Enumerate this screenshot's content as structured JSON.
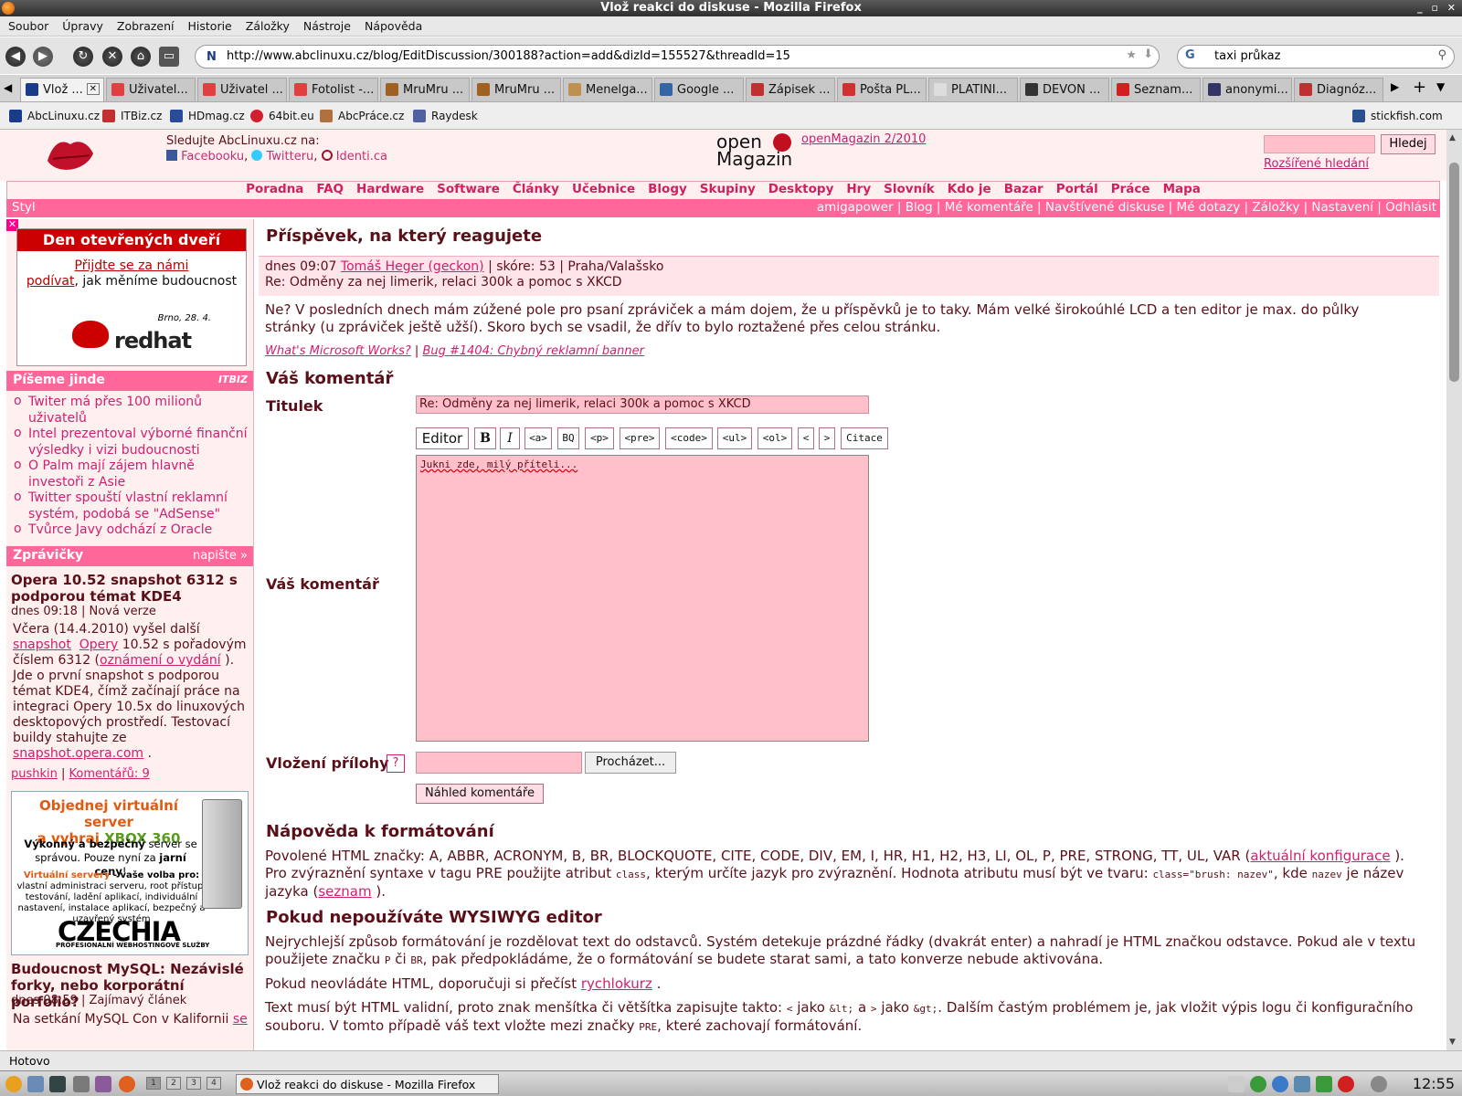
{
  "window": {
    "title": "Vlož reakci do diskuse - Mozilla Firefox"
  },
  "menu": [
    "Soubor",
    "Úpravy",
    "Zobrazení",
    "Historie",
    "Záložky",
    "Nástroje",
    "Nápověda"
  ],
  "nav": {
    "url": "http://www.abclinuxu.cz/blog/EditDiscussion/300188?action=add&dizId=155527&threadId=15",
    "search": "taxi průkaz"
  },
  "tabs": [
    {
      "label": "Vlož ...",
      "color": "#1a3a8a"
    },
    {
      "label": "Uživatel...",
      "color": "#e04040"
    },
    {
      "label": "Uživatel ...",
      "color": "#e04040"
    },
    {
      "label": "Fotolist -...",
      "color": "#e04040"
    },
    {
      "label": "MruMru ...",
      "color": "#a06020"
    },
    {
      "label": "MruMru ...",
      "color": "#a06020"
    },
    {
      "label": "Menelga...",
      "color": "#c09050"
    },
    {
      "label": "Google ...",
      "color": "#3465a4"
    },
    {
      "label": "Zápisek ...",
      "color": "#c03030"
    },
    {
      "label": "Pošta PL...",
      "color": "#d03030"
    },
    {
      "label": "PLATINI...",
      "color": "#dddddd"
    },
    {
      "label": "DEVON ...",
      "color": "#333333"
    },
    {
      "label": "Seznam...",
      "color": "#d02020"
    },
    {
      "label": "anonymi...",
      "color": "#333366"
    },
    {
      "label": "Diagnóz...",
      "color": "#c03030"
    }
  ],
  "bookmarks": [
    "AbcLinuxu.cz",
    "ITBiz.cz",
    "HDmag.cz",
    "64bit.eu",
    "AbcPráce.cz",
    "Raydesk"
  ],
  "bookmark_right": "stickfish.com",
  "header": {
    "follow_label": "Sledujte AbcLinuxu.cz na:",
    "facebook": "Facebooku",
    "twitter": "Twitteru",
    "identica": "Identi.ca",
    "om_logo_1": "open",
    "om_logo_2": "Magazin",
    "om_link": "openMagazin 2/2010",
    "search_button": "Hledej",
    "advanced_search": "Rozšířené hledání"
  },
  "topnav": [
    "Poradna",
    "FAQ",
    "Hardware",
    "Software",
    "Články",
    "Učebnice",
    "Blogy",
    "Skupiny",
    "Desktopy",
    "Hry",
    "Slovník",
    "Kdo je",
    "Bazar",
    "Portál",
    "Práce",
    "Mapa"
  ],
  "userbar": {
    "styl": "Styl",
    "links": "amigapower | Blog | Mé komentáře | Navštívené diskuse | Mé dotazy | Záložky | Nastavení | Odhlásit"
  },
  "sidebar": {
    "ad": {
      "title": "Den otevřených dveří",
      "link1": "Přijdte se za námi",
      "link2": "podívat",
      "text": ", jak měníme budoucnost",
      "date": "Brno, 28. 4.",
      "brand": "redhat"
    },
    "piseme": {
      "title": "Píšeme jinde",
      "badge": "ITBIZ",
      "items": [
        "Twiter má přes 100 milionů uživatelů",
        "Intel prezentoval výborné finanční výsledky i vizi budoucnosti",
        "O Palm mají zájem hlavně investoři z Asie",
        "Twitter spouští vlastní reklamní systém, podobá se \"AdSense\"",
        "Tvůrce Javy odchází z Oracle"
      ]
    },
    "zpravicky": {
      "title": "Zprávičky",
      "action": "napište »"
    },
    "news1": {
      "title": "Opera 10.52 snapshot 6312 s podporou témat KDE4",
      "meta": "dnes 09:18 | Nová verze",
      "t1": "Včera (14.4.2010) vyšel další ",
      "l1": "snapshot",
      "l2": "Opery",
      "t2": " 10.52 s pořadovým číslem 6312 (",
      "l3": "oznámení o vydání",
      "t3": " ). Jde o první snapshot s podporou témat KDE4, čímž začínají práce na integraci Opery 10.5x do linuxových desktopových prostředí. Testovací buildy stahujte ze ",
      "l4": "snapshot.opera.com",
      "t4": " .",
      "author": "pushkin",
      "comments": "Komentářů: 9"
    },
    "czechia": {
      "t1a": "Objednej virtuální server",
      "t1b": "a vyhraj ",
      "t1c": "XBOX 360",
      "t2a": "Výkonný a bezpečný",
      "t2b": " server se správou. Pouze nyní za ",
      "t2c": "jarní ceny",
      "t2d": "!",
      "t3a": "Virtuální servery",
      "t3b": " - vaše volba pro:",
      "t3c": "vlastní administraci serveru, root přístup, testování, ladění aplikací, individuální nastavení, instalace aplikací, bezpečný a uzavřený systém",
      "logo": "CZECHIA",
      "sub": "PROFESIONÁLNÍ WEBHOSTINGOVÉ SLUŽBY"
    },
    "news2": {
      "title": "Budoucnost MySQL: Nezávislé forky, nebo korporátní porfolio?",
      "meta": "dnes 08:59 | Zajímavý článek",
      "t1": "Na setkání MySQL Con v Kalifornii ",
      "l1": "se"
    }
  },
  "main": {
    "orig_heading": "Příspěvek, na který reagujete",
    "orig_time": "dnes 09:07 ",
    "orig_author": "Tomáš Heger (geckon)",
    "orig_meta": " | skóre: 53 | Praha/Valašsko",
    "orig_subject": "Re: Odměny za nej limerik, relaci 300k a pomoc s XKCD",
    "orig_text": "Ne? V posledních dnech mám zúžené pole pro psaní zpráviček a mám dojem, že u příspěvků je to taky. Mám velké širokoúhlé LCD a ten editor je max. do půlky stránky (u zpráviček ještě užší). Skoro bych se vsadil, že dřív to bylo roztažené přes celou stránku.",
    "sig1": "What's Microsoft Works?",
    "sig_sep": " | ",
    "sig2": "Bug #1404: Chybný reklamní banner",
    "comment_heading": "Váš komentář",
    "title_label": "Titulek",
    "title_value": "Re: Odměny za nej limerik, relaci 300k a pomoc s XKCD",
    "toolbar": [
      "Editor",
      "B",
      "I",
      "<a>",
      "BQ",
      "<p>",
      "<pre>",
      "<code>",
      "<ul>",
      "<ol>",
      "<",
      ">",
      "Citace"
    ],
    "comment_label": "Váš komentář",
    "comment_value": "Jukni zde, milý příteli...",
    "attach_label": "Vložení přílohy",
    "help": "?",
    "browse": "Procházet...",
    "preview": "Náhled komentáře",
    "fmt_heading": "Nápověda k formátování",
    "fmt1": "Povolené HTML značky: A, ABBR, ACRONYM, B, BR, BLOCKQUOTE, CITE, CODE, DIV, EM, I, HR, H1, H2, H3, LI, OL, P, PRE, STRONG, TT, UL, VAR (",
    "fmt1_link": "aktuální konfigurace",
    "fmt2": " ). Pro zvýraznění syntaxe v tagu PRE použijte atribut ",
    "fmt2_code": "class",
    "fmt3": ", kterým určíte jazyk pro zvýraznění. Hodnota atributu musí být ve tvaru: ",
    "fmt3_code": "class=\"brush: nazev\"",
    "fmt4": ", kde ",
    "fmt4_code": "nazev",
    "fmt5": " je název jazyka (",
    "fmt5_link": "seznam",
    "fmt6": " ).",
    "wy_heading": "Pokud nepoužíváte WYSIWYG editor",
    "wy1a": "Nejrychlejší způsob formátování je rozdělovat text do odstavců. Systém detekuje prázdné řádky (dvakrát enter) a nahradí je HTML značkou odstavce. Pokud ale v textu použijete značku ",
    "wy1_code1": "P",
    "wy1b": " či ",
    "wy1_code2": "BR",
    "wy1c": ", pak předpokládáme, že o formátování se budete starat sami, a tato konverze nebude aktivována.",
    "wy2a": "Pokud neovládáte HTML, doporučuji si přečíst ",
    "wy2_link": "rychlokurz",
    "wy2b": " .",
    "wy3a": "Text musí být HTML validní, proto znak menšítka či většítka zapisujte takto: ",
    "wy3_c1": "<",
    "wy3b": " jako ",
    "wy3_c2": "&lt;",
    "wy3c": " a ",
    "wy3_c3": ">",
    "wy3d": " jako ",
    "wy3_c4": "&gt;",
    "wy3e": ". Dalším častým problémem je, jak vložit výpis logu či konfiguračního souboru. V tomto případě váš text vložte mezi značky ",
    "wy3_c5": "PRE",
    "wy3f": ", které zachovají formátování."
  },
  "status": "Hotovo",
  "taskbar": {
    "workspaces": [
      "1",
      "2",
      "3",
      "4"
    ],
    "window": "Vlož reakci do diskuse - Mozilla Firefox",
    "clock": "12:55"
  }
}
